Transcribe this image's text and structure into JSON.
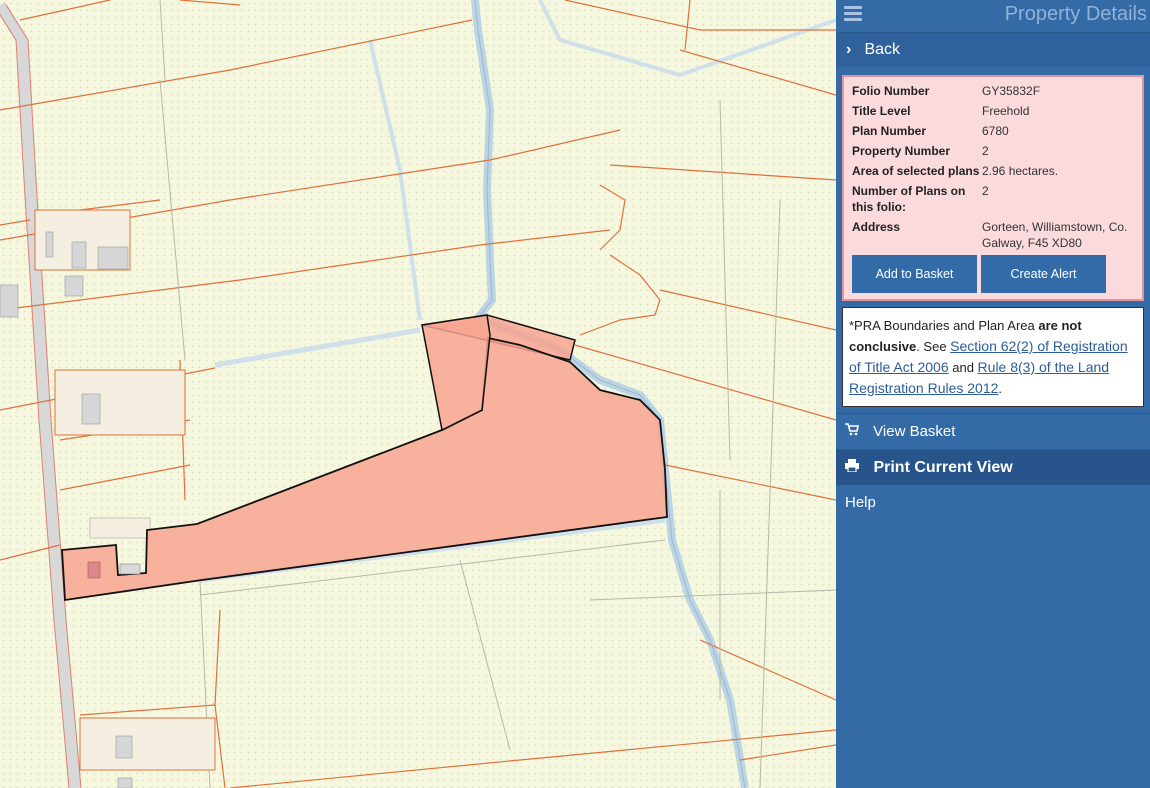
{
  "panel": {
    "title": "Property Details",
    "back_label": "Back",
    "details": [
      {
        "label": "Folio Number",
        "value": "GY35832F"
      },
      {
        "label": "Title Level",
        "value": "Freehold"
      },
      {
        "label": "Plan Number",
        "value": "6780"
      },
      {
        "label": "Property Number",
        "value": "2"
      },
      {
        "label": "Area of selected plans",
        "value": "2.96 hectares."
      },
      {
        "label": "Number of Plans on this folio:",
        "value": "2"
      },
      {
        "label": "Address",
        "value": "Gorteen, Williamstown, Co. Galway, F45 XD80"
      }
    ],
    "buttons": {
      "add_to_basket": "Add to Basket",
      "create_alert": "Create Alert"
    },
    "disclaimer": {
      "prefix": "*PRA Boundaries and Plan Area ",
      "bold": "are not conclusive",
      "see": ". See ",
      "link1": "Section 62(2) of Registration of Title Act 2006",
      "and": " and ",
      "link2": "Rule 8(3) of the Land Registration Rules 2012",
      "suffix": "."
    },
    "menu": {
      "view_basket": "View Basket",
      "print_current_view": "Print Current View",
      "help": "Help"
    },
    "icons": {
      "menu": "hamburger-icon",
      "back": "chevron-right-icon",
      "basket": "cart-icon",
      "print": "printer-icon"
    }
  },
  "map": {
    "colors": {
      "background": "#f5f7df",
      "boundary": "#e0703c",
      "water": "#c6dce8",
      "selected_fill": "#f7a592",
      "selected_outline": "#111111"
    }
  }
}
